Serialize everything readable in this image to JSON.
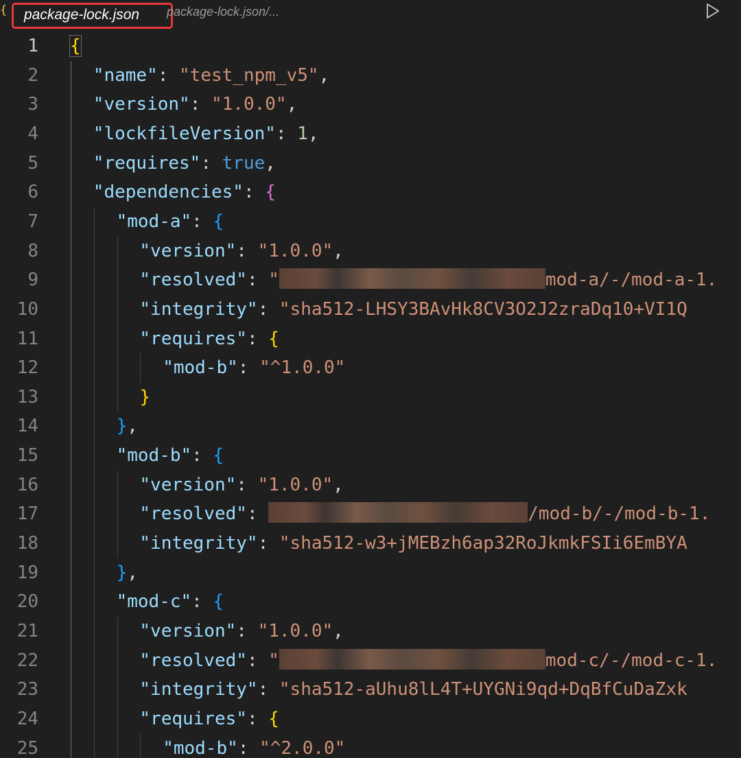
{
  "tab": {
    "icon": "braces-json-icon",
    "title": "package-lock.json",
    "breadcrumb": "package-lock.json/..."
  },
  "colors": {
    "key": "#9cdcfe",
    "string": "#ce9178",
    "number": "#b5cea8",
    "keyword": "#569cd6",
    "bracket_yellow": "#ffd700",
    "bracket_purple": "#da70d6",
    "bracket_blue": "#179fff",
    "tab_highlight": "#e8363b"
  },
  "lines": [
    {
      "n": "1",
      "indent": 0,
      "t": [
        [
          "{",
          "br1"
        ]
      ]
    },
    {
      "n": "2",
      "indent": 1,
      "t": [
        [
          "\"name\"",
          "k"
        ],
        [
          ": ",
          "p"
        ],
        [
          "\"test_npm_v5\"",
          "s"
        ],
        [
          ",",
          "p"
        ]
      ]
    },
    {
      "n": "3",
      "indent": 1,
      "t": [
        [
          "\"version\"",
          "k"
        ],
        [
          ": ",
          "p"
        ],
        [
          "\"1.0.0\"",
          "s"
        ],
        [
          ",",
          "p"
        ]
      ]
    },
    {
      "n": "4",
      "indent": 1,
      "t": [
        [
          "\"lockfileVersion\"",
          "k"
        ],
        [
          ": ",
          "p"
        ],
        [
          "1",
          "n"
        ],
        [
          ",",
          "p"
        ]
      ]
    },
    {
      "n": "5",
      "indent": 1,
      "t": [
        [
          "\"requires\"",
          "k"
        ],
        [
          ": ",
          "p"
        ],
        [
          "true",
          "b"
        ],
        [
          ",",
          "p"
        ]
      ]
    },
    {
      "n": "6",
      "indent": 1,
      "t": [
        [
          "\"dependencies\"",
          "k"
        ],
        [
          ": ",
          "p"
        ],
        [
          "{",
          "br2"
        ]
      ]
    },
    {
      "n": "7",
      "indent": 2,
      "t": [
        [
          "\"mod-a\"",
          "k"
        ],
        [
          ": ",
          "p"
        ],
        [
          "{",
          "br3"
        ]
      ]
    },
    {
      "n": "8",
      "indent": 3,
      "t": [
        [
          "\"version\"",
          "k"
        ],
        [
          ": ",
          "p"
        ],
        [
          "\"1.0.0\"",
          "s"
        ],
        [
          ",",
          "p"
        ]
      ]
    },
    {
      "n": "9",
      "indent": 3,
      "t": [
        [
          "\"resolved\"",
          "k"
        ],
        [
          ": ",
          "p"
        ],
        [
          "\"",
          "s"
        ],
        [
          "",
          "redact"
        ],
        [
          "mod-a/-/mod-a-1.",
          "s"
        ]
      ]
    },
    {
      "n": "10",
      "indent": 3,
      "t": [
        [
          "\"integrity\"",
          "k"
        ],
        [
          ": ",
          "p"
        ],
        [
          "\"sha512-LHSY3BAvHk8CV3O2J2zraDq10+VI1Q",
          "s"
        ]
      ]
    },
    {
      "n": "11",
      "indent": 3,
      "t": [
        [
          "\"requires\"",
          "k"
        ],
        [
          ": ",
          "p"
        ],
        [
          "{",
          "br1"
        ]
      ]
    },
    {
      "n": "12",
      "indent": 4,
      "t": [
        [
          "\"mod-b\"",
          "k"
        ],
        [
          ": ",
          "p"
        ],
        [
          "\"^1.0.0\"",
          "s"
        ]
      ]
    },
    {
      "n": "13",
      "indent": 3,
      "t": [
        [
          "}",
          "br1"
        ]
      ]
    },
    {
      "n": "14",
      "indent": 2,
      "t": [
        [
          "}",
          "br3"
        ],
        [
          ",",
          "p"
        ]
      ]
    },
    {
      "n": "15",
      "indent": 2,
      "t": [
        [
          "\"mod-b\"",
          "k"
        ],
        [
          ": ",
          "p"
        ],
        [
          "{",
          "br3"
        ]
      ]
    },
    {
      "n": "16",
      "indent": 3,
      "t": [
        [
          "\"version\"",
          "k"
        ],
        [
          ": ",
          "p"
        ],
        [
          "\"1.0.0\"",
          "s"
        ],
        [
          ",",
          "p"
        ]
      ]
    },
    {
      "n": "17",
      "indent": 3,
      "t": [
        [
          "\"resolved\"",
          "k"
        ],
        [
          ": ",
          "p"
        ],
        [
          "",
          "redact"
        ],
        [
          "/mod-b/-/mod-b-1.",
          "s"
        ]
      ]
    },
    {
      "n": "18",
      "indent": 3,
      "t": [
        [
          "\"integrity\"",
          "k"
        ],
        [
          ": ",
          "p"
        ],
        [
          "\"sha512-w3+jMEBzh6ap32RoJkmkFSIi6EmBYA",
          "s"
        ]
      ]
    },
    {
      "n": "19",
      "indent": 2,
      "t": [
        [
          "}",
          "br3"
        ],
        [
          ",",
          "p"
        ]
      ]
    },
    {
      "n": "20",
      "indent": 2,
      "t": [
        [
          "\"mod-c\"",
          "k"
        ],
        [
          ": ",
          "p"
        ],
        [
          "{",
          "br3"
        ]
      ]
    },
    {
      "n": "21",
      "indent": 3,
      "t": [
        [
          "\"version\"",
          "k"
        ],
        [
          ": ",
          "p"
        ],
        [
          "\"1.0.0\"",
          "s"
        ],
        [
          ",",
          "p"
        ]
      ]
    },
    {
      "n": "22",
      "indent": 3,
      "t": [
        [
          "\"resolved\"",
          "k"
        ],
        [
          ": ",
          "p"
        ],
        [
          "\"",
          "s"
        ],
        [
          "",
          "redact"
        ],
        [
          "mod-c/-/mod-c-1.",
          "s"
        ]
      ]
    },
    {
      "n": "23",
      "indent": 3,
      "t": [
        [
          "\"integrity\"",
          "k"
        ],
        [
          ": ",
          "p"
        ],
        [
          "\"sha512-aUhu8lL4T+UYGNi9qd+DqBfCuDaZxk",
          "s"
        ]
      ]
    },
    {
      "n": "24",
      "indent": 3,
      "t": [
        [
          "\"requires\"",
          "k"
        ],
        [
          ": ",
          "p"
        ],
        [
          "{",
          "br1"
        ]
      ]
    },
    {
      "n": "25",
      "indent": 4,
      "t": [
        [
          "\"mod-b\"",
          "k"
        ],
        [
          ": ",
          "p"
        ],
        [
          "\"^2.0.0\"",
          "s"
        ]
      ]
    }
  ]
}
